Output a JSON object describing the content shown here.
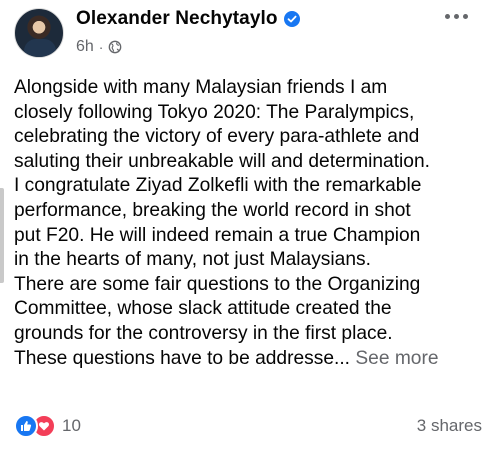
{
  "post": {
    "author": "Olexander Nechytaylo",
    "time": "6h",
    "meta_separator": "·",
    "lines": [
      "Alongside with many Malaysian friends I am",
      "closely following Tokyo 2020: The Paralympics,",
      "celebrating the victory of every para-athlete and",
      "saluting their unbreakable will and determination.",
      "I congratulate Ziyad Zolkefli with the remarkable",
      "performance, breaking the world record in shot",
      "put F20. He will indeed remain a true Champion",
      "in the hearts of many, not just Malaysians.",
      "There are some fair questions to the Organizing",
      "Committee, whose slack attitude created the",
      "grounds for the controversy in the first place."
    ],
    "last_line": "These questions have to be addresse...",
    "see_more": "See more"
  },
  "footer": {
    "reaction_count": "10",
    "shares": "3 shares"
  },
  "icons": {
    "verified": "verified-badge-icon",
    "privacy": "globe-icon",
    "more": "more-options-icon",
    "like": "like-reaction-icon",
    "love": "love-reaction-icon"
  },
  "colors": {
    "accent": "#1877f2",
    "love": "#f33e58",
    "secondary_text": "#65676b"
  }
}
